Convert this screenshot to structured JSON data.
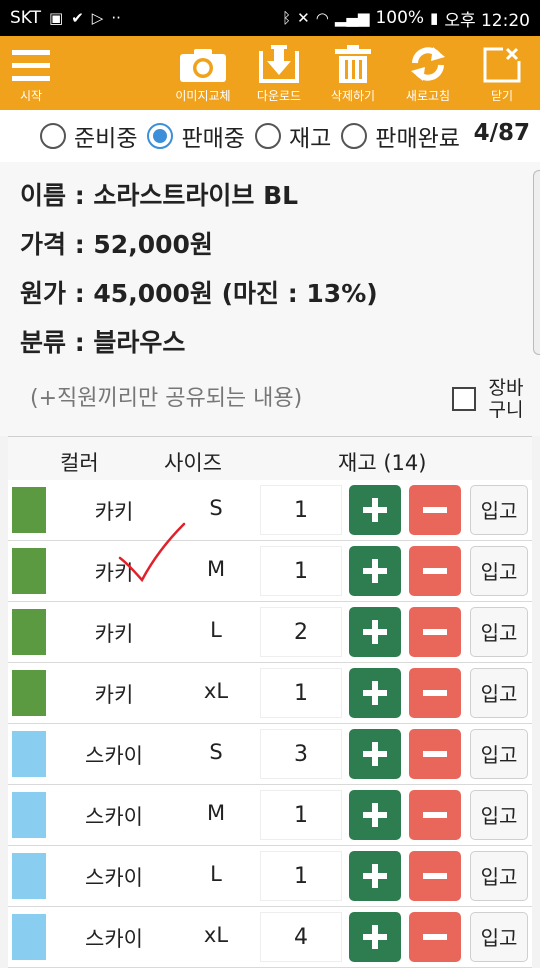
{
  "status_bar": {
    "carrier": "SKT",
    "battery": "100%",
    "time": "오후 12:20"
  },
  "toolbar": {
    "menu_label": "시작",
    "change_image_label": "이미지교체",
    "download_label": "다운로드",
    "delete_label": "삭제하기",
    "refresh_label": "새로고침",
    "close_label": "닫기"
  },
  "status_options": [
    {
      "label": "준비중",
      "selected": false
    },
    {
      "label": "판매중",
      "selected": true
    },
    {
      "label": "재고",
      "selected": false
    },
    {
      "label": "판매완료",
      "selected": false
    }
  ],
  "pager": "4/87",
  "product": {
    "name_line": "이름 : 소라스트라이브 BL",
    "price_line": "가격 : 52,000원",
    "cost_line": "원가 : 45,000원 (마진 : 13%)",
    "category_line": "분류 : 블라우스",
    "memo_placeholder": "(+직원끼리만 공유되는 내용)",
    "cart_label_1": "장바",
    "cart_label_2": "구니"
  },
  "table": {
    "headers": {
      "color": "컬러",
      "size": "사이즈",
      "stock": "재고 (14)"
    },
    "in_label": "입고",
    "rows": [
      {
        "color_name": "카키",
        "swatch": "#5b9a41",
        "size": "S",
        "qty": "1"
      },
      {
        "color_name": "카키",
        "swatch": "#5b9a41",
        "size": "M",
        "qty": "1"
      },
      {
        "color_name": "카키",
        "swatch": "#5b9a41",
        "size": "L",
        "qty": "2"
      },
      {
        "color_name": "카키",
        "swatch": "#5b9a41",
        "size": "xL",
        "qty": "1"
      },
      {
        "color_name": "스카이",
        "swatch": "#89cdf0",
        "size": "S",
        "qty": "3"
      },
      {
        "color_name": "스카이",
        "swatch": "#89cdf0",
        "size": "M",
        "qty": "1"
      },
      {
        "color_name": "스카이",
        "swatch": "#89cdf0",
        "size": "L",
        "qty": "1"
      },
      {
        "color_name": "스카이",
        "swatch": "#89cdf0",
        "size": "xL",
        "qty": "4"
      }
    ]
  },
  "colors": {
    "accent": "#f0a21c",
    "plus": "#2e7d50",
    "minus": "#e8665a",
    "radio": "#3c8fd8",
    "check_mark": "#e0212b"
  },
  "icons": [
    "image-icon",
    "battery-icon",
    "wifi-icon",
    "signal-icon",
    "bluetooth-icon",
    "mute-icon",
    "camera-icon",
    "download-icon",
    "trash-icon",
    "refresh-icon",
    "close-icon",
    "menu-icon",
    "check-mark-icon"
  ]
}
